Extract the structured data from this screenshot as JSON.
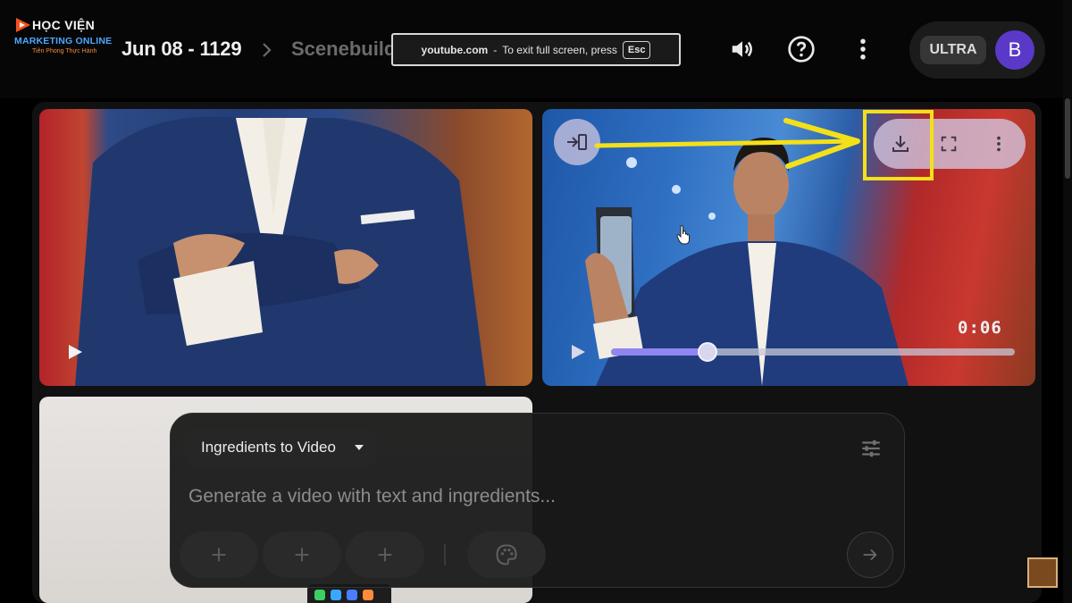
{
  "logo": {
    "line1": "HỌC VIỆN",
    "line2": "MARKETING ONLINE",
    "line3": "Tiên Phong Thực Hành",
    "accent": "#f4511e"
  },
  "breadcrumb": {
    "project": "Jun 08 - 1129",
    "current": "Scenebuilder"
  },
  "fullscreen_banner": {
    "domain": "youtube.com",
    "separator": "-",
    "message": "To exit full screen, press",
    "key": "Esc"
  },
  "header": {
    "icons": [
      "volume-icon",
      "help-icon",
      "more-vert-icon"
    ],
    "plan_badge": "ULTRA",
    "avatar_letter": "B",
    "avatar_color": "#5b39c8"
  },
  "video_tile": {
    "time": "0:06",
    "progress": 0.24,
    "controls": [
      "extend-icon",
      "download-icon",
      "fullscreen-icon",
      "more-vert-icon"
    ],
    "highlight_color": "#f4e019",
    "highlighted_control": "download-icon"
  },
  "prompt_panel": {
    "mode_label": "Ingredients to Video",
    "placeholder": "Generate a video with text and ingredients...",
    "ingredient_slots": 3,
    "icons": [
      "tune-icon",
      "add-icon",
      "palette-icon",
      "arrow-forward-icon"
    ]
  }
}
